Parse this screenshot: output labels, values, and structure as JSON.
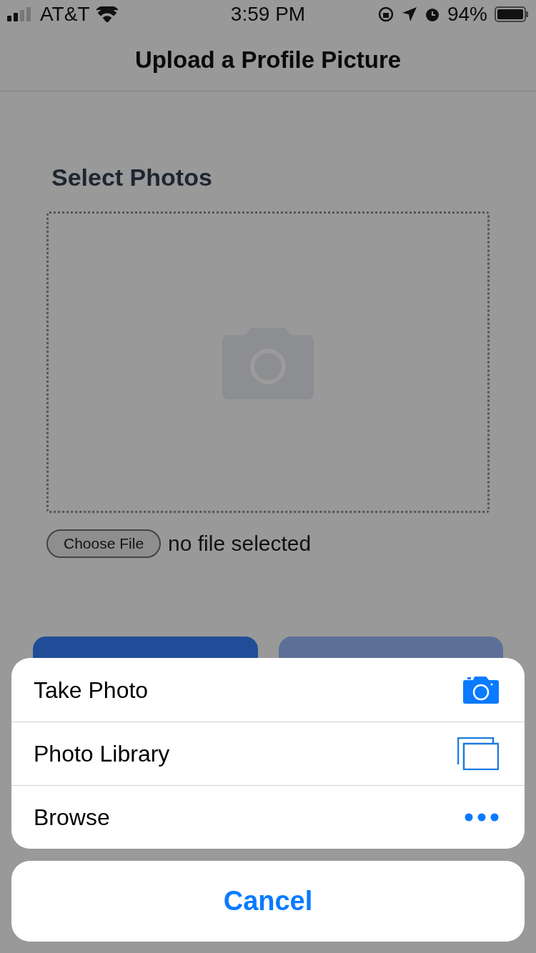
{
  "status_bar": {
    "carrier": "AT&T",
    "time": "3:59 PM",
    "battery": "94%"
  },
  "nav_bar": {
    "title": "Upload a Profile Picture"
  },
  "form": {
    "heading": "Select Photos",
    "choose_button": "Choose File",
    "file_status": "no file selected",
    "buttons": [
      {
        "kind": "primary"
      },
      {
        "kind": "secondary"
      }
    ]
  },
  "action_sheet": {
    "items": [
      {
        "label": "Take Photo",
        "kind": "camera"
      },
      {
        "label": "Photo Library",
        "kind": "library"
      },
      {
        "label": "Browse",
        "kind": "more"
      }
    ],
    "cancel": "Cancel"
  }
}
